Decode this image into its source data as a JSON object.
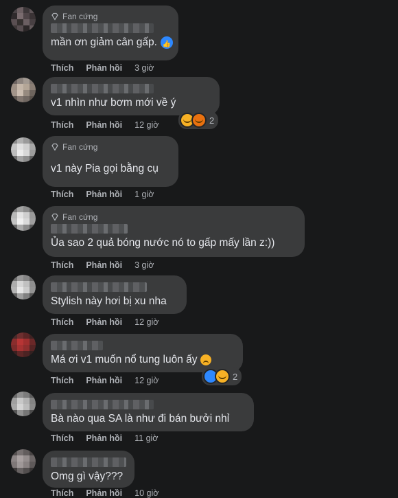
{
  "actions": {
    "like": "Thích",
    "reply": "Phản hồi"
  },
  "badge_label": "Fan cứng",
  "comments": [
    {
      "text": "mần ơn giảm cân gấp.",
      "time": "3 giờ"
    },
    {
      "text": "v1 nhìn như bơm mới về ý",
      "time": "12 giờ",
      "reaction_count": "2"
    },
    {
      "text": "v1 này Pia gọi bằng cụ",
      "time": "1 giờ"
    },
    {
      "text": "Ủa sao 2 quả bóng nước nó to gấp mấy lần z:))",
      "time": "3 giờ"
    },
    {
      "text": "Stylish này hơi bị xu nha",
      "time": "12 giờ"
    },
    {
      "text": "Má ơi v1 muốn nổ tung luôn ấy",
      "time": "12 giờ",
      "reaction_count": "2"
    },
    {
      "text": "Bà nào qua SA là như đi bán bưởi nhỉ",
      "time": "11 giờ"
    },
    {
      "text": "Omg gì vậy???",
      "time": "10 giờ"
    }
  ],
  "colors": {
    "background": "#18191a",
    "bubble": "#3a3b3c",
    "secondary_text": "#b0b3b8",
    "like_blue": "#2d88ff"
  }
}
